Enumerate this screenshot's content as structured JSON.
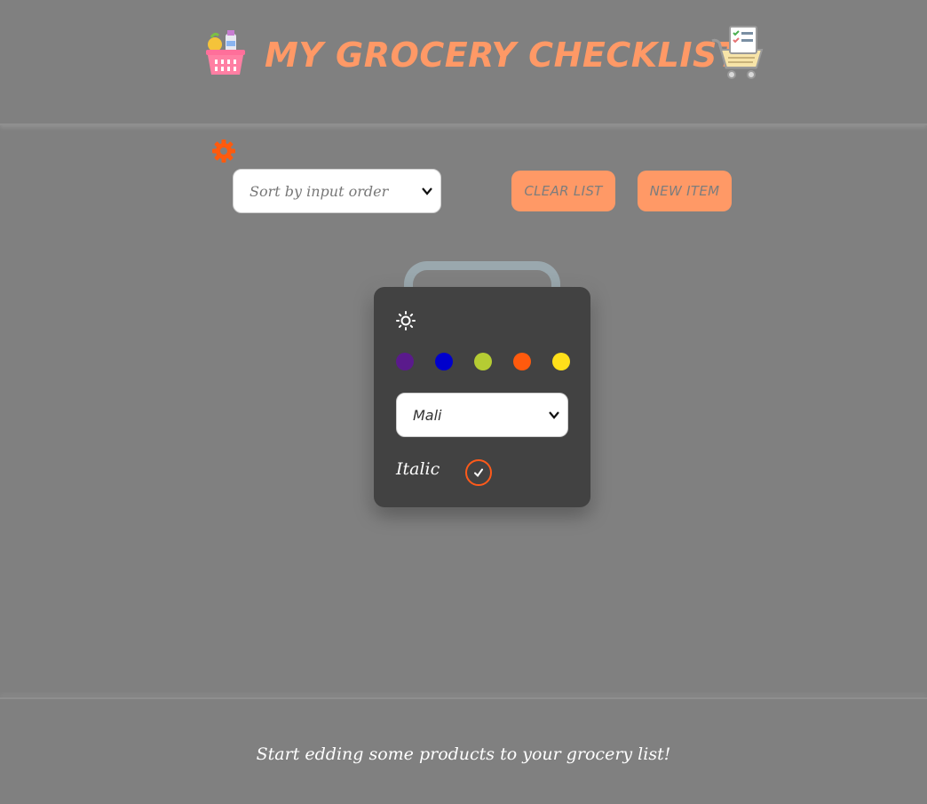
{
  "header": {
    "title": "MY GROCERY CHECKLIST",
    "left_icon": "grocery-basket-icon",
    "right_icon": "checklist-cart-icon",
    "title_color": "#ff9966"
  },
  "toolbar": {
    "settings_icon": "gear-icon",
    "sort_select": {
      "value": "Sort by input order"
    },
    "clear_label": "CLEAR LIST",
    "new_label": "NEW ITEM",
    "button_color": "#ff9966"
  },
  "settings_panel": {
    "theme_icon": "sun-icon",
    "colors": [
      {
        "name": "purple",
        "hex": "#5a1a8c"
      },
      {
        "name": "blue",
        "hex": "#0000cc"
      },
      {
        "name": "lime",
        "hex": "#b5cc33"
      },
      {
        "name": "orange",
        "hex": "#ff5a0d"
      },
      {
        "name": "yellow",
        "hex": "#ffe01a"
      }
    ],
    "font_select": {
      "value": "Mali"
    },
    "italic_label": "Italic",
    "italic_checked": true
  },
  "footer": {
    "message": "Start edding some products to your grocery list!"
  }
}
